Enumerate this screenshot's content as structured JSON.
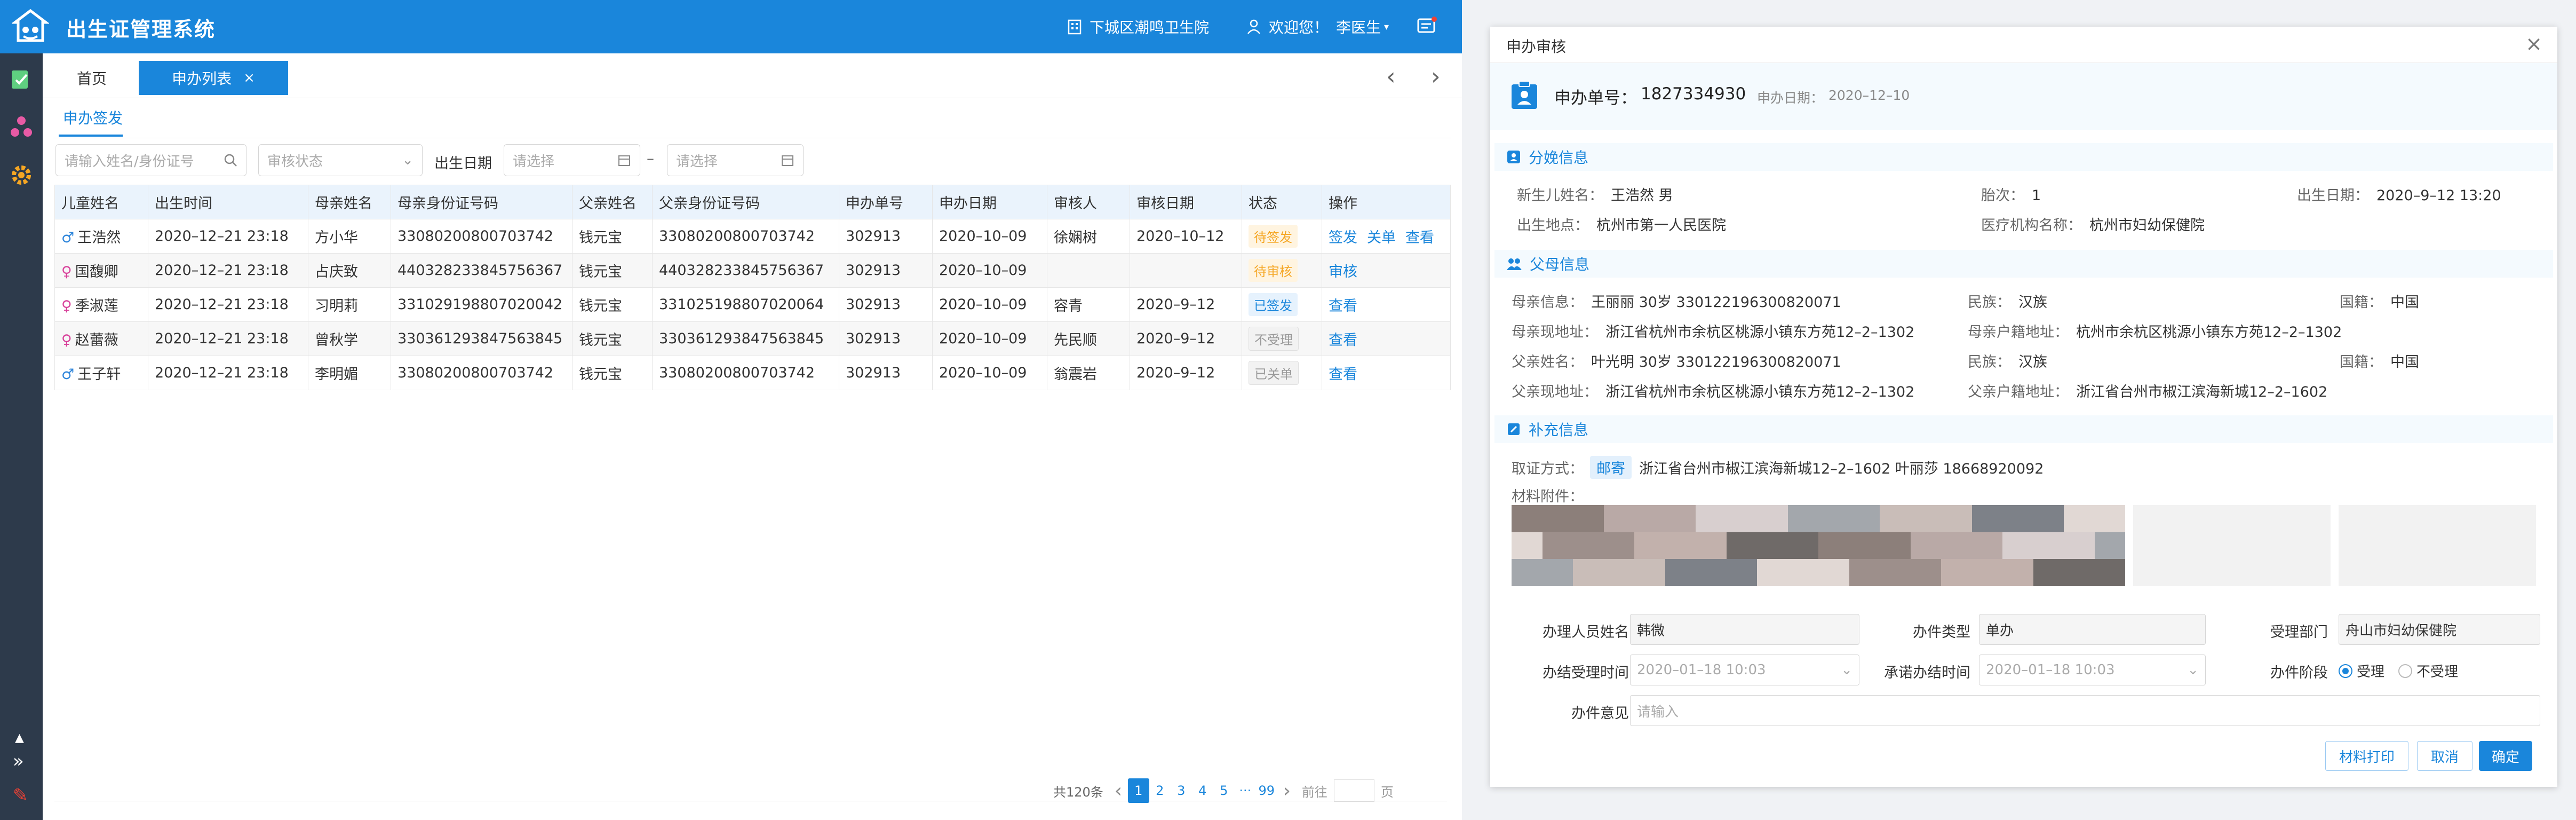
{
  "header": {
    "title": "出生证管理系统",
    "hospital": "下城区潮鸣卫生院",
    "welcome": "欢迎您！",
    "user": "李医生"
  },
  "tabs": [
    {
      "label": "首页"
    },
    {
      "label": "申办列表"
    }
  ],
  "subtab": "申办签发",
  "filters": {
    "search_placeholder": "请输入姓名/身份证号",
    "status_placeholder": "审核状态",
    "birthdate_label": "出生日期",
    "date_start_placeholder": "请选择",
    "date_separator": "–",
    "date_end_placeholder": "请选择"
  },
  "table": {
    "headers": [
      "儿童姓名",
      "出生时间",
      "母亲姓名",
      "母亲身份证号码",
      "父亲姓名",
      "父亲身份证号码",
      "申办单号",
      "申办日期",
      "审核人",
      "审核日期",
      "状态",
      "操作"
    ],
    "rows": [
      {
        "gender": "m",
        "gender_symbol": "♂",
        "child": "王浩然",
        "birth": "2020–12–21   23:18",
        "mother": "方小华",
        "mother_id": "33080200800703742",
        "father": "钱元宝",
        "father_id": "33080200800703742",
        "order": "302913",
        "apply_date": "2020–10–09",
        "reviewer": "徐娴树",
        "review_date": "2020–10–12",
        "status": "待签发",
        "status_style": "b-orange",
        "ops": [
          "签发",
          "关单",
          "查看"
        ]
      },
      {
        "gender": "f",
        "gender_symbol": "♀",
        "child": "国馥卿",
        "birth": "2020–12–21   23:18",
        "mother": "占庆致",
        "mother_id": "440328233845756367",
        "father": "钱元宝",
        "father_id": "440328233845756367",
        "order": "302913",
        "apply_date": "2020–10–09",
        "reviewer": "",
        "review_date": "",
        "status": "待审核",
        "status_style": "b-orange",
        "ops": [
          "审核"
        ]
      },
      {
        "gender": "f",
        "gender_symbol": "♀",
        "child": "季淑莲",
        "birth": "2020–12–21   23:18",
        "mother": "习明莉",
        "mother_id": "331029198807020042",
        "father": "钱元宝",
        "father_id": "331025198807020064",
        "order": "302913",
        "apply_date": "2020–10–09",
        "reviewer": "容青",
        "review_date": "2020–9–12",
        "status": "已签发",
        "status_style": "b-blue",
        "ops": [
          "查看"
        ]
      },
      {
        "gender": "f",
        "gender_symbol": "♀",
        "child": "赵蕾薇",
        "birth": "2020–12–21   23:18",
        "mother": "曾秋学",
        "mother_id": "330361293847563845",
        "father": "钱元宝",
        "father_id": "330361293847563845",
        "order": "302913",
        "apply_date": "2020–10–09",
        "reviewer": "先民顺",
        "review_date": "2020–9–12",
        "status": "不受理",
        "status_style": "b-gray",
        "ops": [
          "查看"
        ]
      },
      {
        "gender": "m",
        "gender_symbol": "♂",
        "child": "王子轩",
        "birth": "2020–12–21   23:18",
        "mother": "李明媚",
        "mother_id": "33080200800703742",
        "father": "钱元宝",
        "father_id": "33080200800703742",
        "order": "302913",
        "apply_date": "2020–10–09",
        "reviewer": "翁震岩",
        "review_date": "2020–9–12",
        "status": "已关单",
        "status_style": "b-gray",
        "ops": [
          "查看"
        ]
      }
    ]
  },
  "pagination": {
    "total": "共120条",
    "pages": [
      "1",
      "2",
      "3",
      "4",
      "5"
    ],
    "ellipsis": "···",
    "last": "99",
    "goto": "前往",
    "page_unit": "页"
  },
  "modal": {
    "title": "申办审核",
    "apply_no_label": "申办单号：",
    "apply_no": "1827334930",
    "apply_date_label": "申办日期：",
    "apply_date": "2020–12–10",
    "sections": {
      "delivery": "分娩信息",
      "parents": "父母信息",
      "extra": "补充信息"
    },
    "delivery": {
      "newborn_label": "新生儿姓名：",
      "newborn": "王浩然  男",
      "parity_label": "胎次：",
      "parity": "1",
      "birthdate_label": "出生日期：",
      "birthdate": "2020–9–12  13:20",
      "place_label": "出生地点：",
      "place": "杭州市第一人民医院",
      "org_label": "医疗机构名称：",
      "org": "杭州市妇幼保健院"
    },
    "parents": {
      "mother_info_label": "母亲信息：",
      "mother_info": "王丽丽   30岁   330122196300820071",
      "mother_ethnic_label": "民族：",
      "mother_ethnic": "汉族",
      "mother_nation_label": "国籍：",
      "mother_nation": "中国",
      "mother_addr_label": "母亲现地址：",
      "mother_addr": "浙江省杭州市余杭区桃源小镇东方苑12–2–1302",
      "mother_reg_label": "母亲户籍地址：",
      "mother_reg": "杭州市余杭区桃源小镇东方苑12–2–1302",
      "father_name_label": "父亲姓名：",
      "father_info": "叶光明   30岁   330122196300820071",
      "father_ethnic_label": "民族：",
      "father_ethnic": "汉族",
      "father_nation_label": "国籍：",
      "father_nation": "中国",
      "father_addr_label": "父亲现地址：",
      "father_addr": "浙江省杭州市余杭区桃源小镇东方苑12–2–1302",
      "father_reg_label": "父亲户籍地址：",
      "father_reg": "浙江省台州市椒江滨海新城12–2–1602"
    },
    "extra": {
      "pickup_label": "取证方式：",
      "pickup_tag": "邮寄",
      "pickup_addr": "浙江省台州市椒江滨海新城12–2–1602   叶丽莎   18668920092",
      "attach_label": "材料附件："
    },
    "form": {
      "handler_label": "办理人员姓名",
      "handler": "韩微",
      "type_label": "办件类型",
      "type": "单办",
      "dept_label": "受理部门",
      "dept": "舟山市妇幼保健院",
      "accept_time_label": "办结受理时间",
      "accept_time": "2020–01–18 10:03",
      "promise_time_label": "承诺办结时间",
      "promise_time": "2020–01–18 10:03",
      "stage_label": "办件阶段",
      "stage_accept": "受理",
      "stage_reject": "不受理",
      "opinion_label": "办件意见",
      "opinion_placeholder": "请输入"
    },
    "buttons": {
      "print": "材料打印",
      "cancel": "取消",
      "ok": "确定"
    }
  },
  "colors": {
    "primary": "#1a86db",
    "sidebar": "#2d3a4b",
    "pending": "#f5a623"
  }
}
